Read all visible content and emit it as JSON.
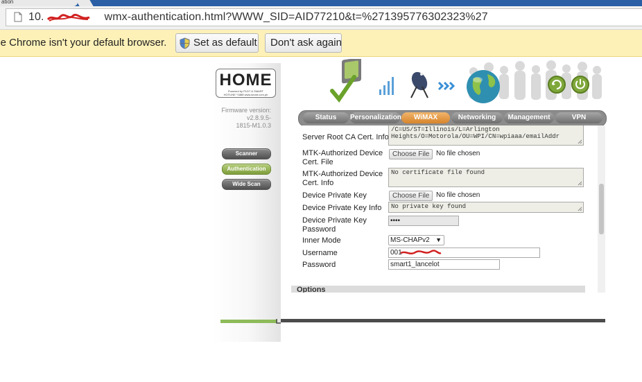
{
  "browser": {
    "tab_fragment": "ation",
    "url_prefix": "10.",
    "url_rest": "wmx-authentication.html?WWW_SID=AID77210&t=%271395776302323%27",
    "infobar_message": "ile Chrome isn't your default browser.",
    "set_default_label": "Set as default",
    "dont_ask_label": "Don't ask again"
  },
  "router": {
    "logo_text": "HOME",
    "logo_sub": "Powered by PLDT & SMART",
    "logo_hotline": "HOTLINE *1888  www.smart.com.ph",
    "firmware_label": "Firmware version:",
    "firmware_value": "v2.8.9.5-1815-M1.0.3",
    "sidebar": {
      "scanner": "Scanner",
      "authentication": "Authentication",
      "wide_scan": "Wide Scan"
    },
    "tabs": [
      "Status",
      "Personalization",
      "WiMAX",
      "Networking",
      "Management",
      "VPN"
    ],
    "active_tab": "WiMAX",
    "form": {
      "server_root_ca_label": "Server Root CA Cert. Info",
      "server_root_ca_value": "/C=US/ST=Illinois/L=Arlington Heights/O=Motorola/OU=WPI/CN=wpiaaa/emailAddr",
      "mtk_device_cert_file_label": "MTK-Authorized Device Cert. File",
      "choose_file_label": "Choose File",
      "no_file_chosen": "No file chosen",
      "mtk_device_cert_info_label": "MTK-Authorized Device Cert. Info",
      "mtk_device_cert_info_value": "No certificate file found",
      "device_private_key_label": "Device Private Key",
      "device_private_key_info_label": "Device Private Key Info",
      "device_private_key_info_value": "No private key found",
      "device_private_key_password_label": "Device Private Key Password",
      "device_private_key_password_value": "••••",
      "inner_mode_label": "Inner Mode",
      "inner_mode_value": "MS-CHAPv2",
      "username_label": "Username",
      "username_value": "001",
      "password_label": "Password",
      "password_value": "smart1_lancelot",
      "options_label": "Options"
    }
  },
  "colors": {
    "tab_active": "#e09438",
    "auth_button": "#8fae4b",
    "infobar_bg": "#fdf1b8"
  },
  "icons": [
    "page-icon",
    "shield-icon",
    "wimax-router-icon",
    "signal-icon",
    "antenna-icon",
    "arrow-icon",
    "globe-icon",
    "refresh-icon",
    "power-icon"
  ]
}
